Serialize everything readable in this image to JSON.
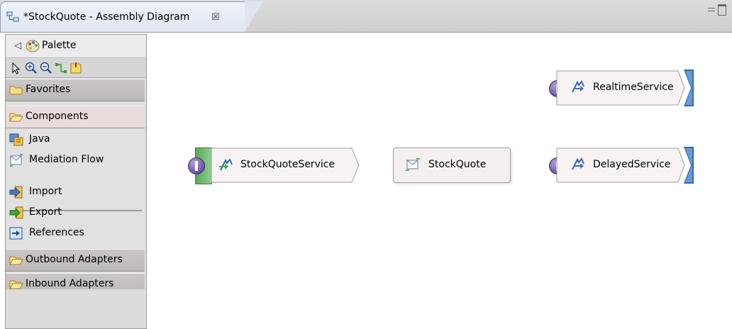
{
  "editor": {
    "tab_title": "*StockQuote - Assembly Diagram",
    "close_glyph": "☒"
  },
  "palette": {
    "collapse_glyph": "◁",
    "title": "Palette",
    "tools": [
      "select-arrow-icon",
      "zoom-in-icon",
      "zoom-out-icon",
      "wire-icon",
      "note-icon"
    ],
    "drawers": {
      "favorites": "Favorites",
      "components": "Components",
      "outbound_adapters": "Outbound Adapters",
      "inbound_adapters": "Inbound Adapters"
    },
    "components": {
      "java": "Java",
      "mediation_flow": "Mediation Flow",
      "import": "Import",
      "export": "Export",
      "references": "References"
    }
  },
  "diagram": {
    "nodes": {
      "export_node": "StockQuoteService",
      "mediation_node": "StockQuote",
      "import_realtime": "RealtimeService",
      "import_delayed": "DelayedService"
    }
  },
  "colors": {
    "interface_purple": "#6e52a8",
    "reference_blue": "#2f6aae",
    "node_fill": "#f5f0f0",
    "palette_bg": "#e1e1e1"
  }
}
